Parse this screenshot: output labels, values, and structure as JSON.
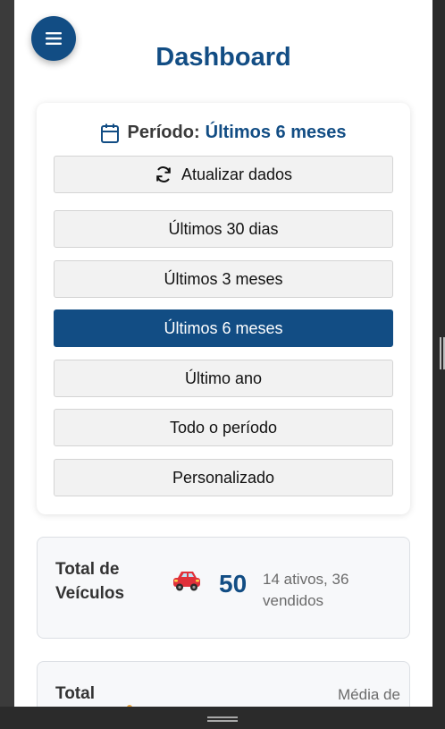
{
  "header": {
    "title": "Dashboard"
  },
  "period": {
    "label": "Período:",
    "value": "Últimos 6 meses",
    "refresh_label": "Atualizar dados",
    "options": [
      "Últimos 30 dias",
      "Últimos 3 meses",
      "Últimos 6 meses",
      "Último ano",
      "Todo o período",
      "Personalizado"
    ],
    "active_option": "Últimos 6 meses"
  },
  "stats": {
    "vehicles": {
      "label": "Total de Veículos",
      "value": "50",
      "detail": "14 ativos, 36 vendidos"
    },
    "second": {
      "label": "Total",
      "detail": "Média de"
    }
  },
  "icons": {
    "menu": "menu-icon",
    "calendar": "calendar-icon",
    "refresh": "refresh-icon",
    "car": "car-icon"
  },
  "colors": {
    "primary": "#124d84",
    "button_bg": "#f2f2f2",
    "text_muted": "#6b6b6b",
    "car": "#e0303a"
  }
}
